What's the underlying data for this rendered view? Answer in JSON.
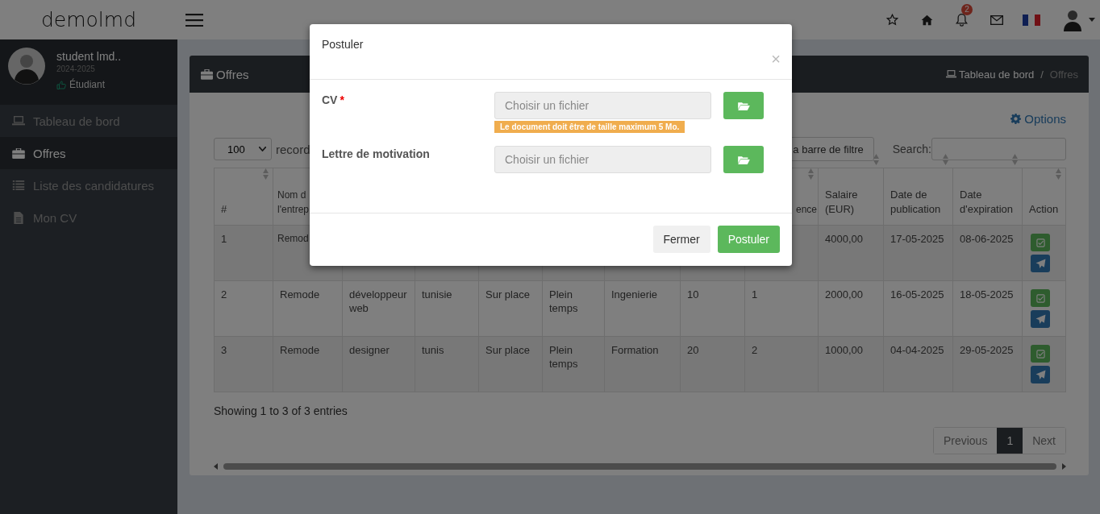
{
  "navbar": {
    "brand": "demolmd",
    "notification_count": "2"
  },
  "sidebar": {
    "user": {
      "name": "student lmd..",
      "year": "2024-2025",
      "role": "Étudiant"
    },
    "items": [
      {
        "label": "Tableau de bord",
        "selected": false
      },
      {
        "label": "Offres",
        "selected": true
      },
      {
        "label": "Liste des candidatures",
        "selected": false
      },
      {
        "label": "Mon CV",
        "selected": false
      }
    ]
  },
  "page": {
    "title": "Offres",
    "breadcrumb": [
      "Tableau de bord",
      "Offres"
    ],
    "separator": "/"
  },
  "options_link": "Options",
  "length_select": {
    "value": "100",
    "label": "record"
  },
  "filter_button": "a barre de filtre",
  "search": {
    "label": "Search:"
  },
  "table": {
    "columns": [
      "#",
      "Nom d l'entrep",
      null,
      null,
      null,
      null,
      null,
      null,
      "ence",
      "Salaire (EUR)",
      "Date de publication",
      "Date d'expiration",
      "Action"
    ],
    "rows": [
      {
        "cells": [
          "1",
          "Remod",
          null,
          null,
          null,
          null,
          null,
          null,
          null,
          "4000,00",
          "17-05-2025",
          "08-06-2025"
        ]
      },
      {
        "cells": [
          "2",
          "Remode",
          "développeur web",
          "tunisie",
          "Sur place",
          "Plein temps",
          "Ingenierie",
          "10",
          "1",
          "2000,00",
          "16-05-2025",
          "18-05-2025"
        ]
      },
      {
        "cells": [
          "3",
          "Remode",
          "designer",
          "tunis",
          "Sur place",
          "Plein temps",
          "Formation",
          "20",
          "2",
          "1000,00",
          "04-04-2025",
          "29-05-2025"
        ]
      }
    ]
  },
  "info": "Showing 1 to 3 of 3 entries",
  "pagination": {
    "previous": "Previous",
    "pages": [
      {
        "label": "1",
        "selected": true
      }
    ],
    "next": "Next"
  },
  "modal": {
    "title": "Postuler",
    "close": "×",
    "fields": [
      {
        "label": "CV",
        "required_mark": "*",
        "placeholder": "Choisir un fichier",
        "hint": "Le document doit être de taille maximum 5 Mo."
      },
      {
        "label": "Lettre de motivation",
        "placeholder": "Choisir un fichier"
      }
    ],
    "buttons": [
      {
        "label": "Fermer",
        "kind": "default"
      },
      {
        "label": "Postuler",
        "kind": "primary"
      }
    ]
  }
}
